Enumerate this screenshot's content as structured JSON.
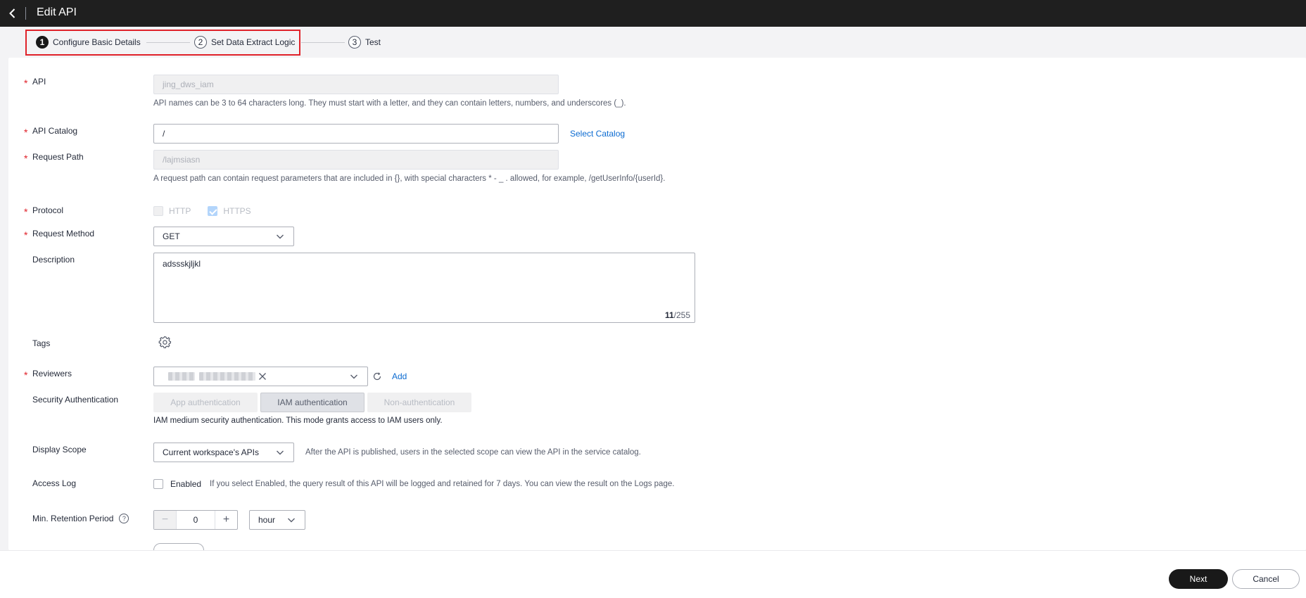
{
  "header": {
    "title": "Edit API"
  },
  "steps": [
    {
      "num": "1",
      "label": "Configure Basic Details"
    },
    {
      "num": "2",
      "label": "Set Data Extract Logic"
    },
    {
      "num": "3",
      "label": "Test"
    }
  ],
  "form": {
    "api": {
      "label": "API",
      "value": "jing_dws_iam",
      "hint": "API names can be 3 to 64 characters long. They must start with a letter, and they can contain letters, numbers, and underscores (_)."
    },
    "catalog": {
      "label": "API Catalog",
      "value": "/",
      "link": "Select Catalog"
    },
    "path": {
      "label": "Request Path",
      "value": "/lajmsiasn",
      "hint": "A request path can contain request parameters that are included in {}, with special characters * - _ . allowed, for example, /getUserInfo/{userId}."
    },
    "protocol": {
      "label": "Protocol",
      "http": "HTTP",
      "https": "HTTPS",
      "https_checked": true
    },
    "method": {
      "label": "Request Method",
      "value": "GET"
    },
    "description": {
      "label": "Description",
      "value": "adssskjljkl",
      "count": "11",
      "max": "/255"
    },
    "tags": {
      "label": "Tags"
    },
    "reviewers": {
      "label": "Reviewers",
      "add": "Add"
    },
    "security": {
      "label": "Security Authentication",
      "options": [
        "App authentication",
        "IAM authentication",
        "Non-authentication"
      ],
      "selected": "IAM authentication",
      "hint": "IAM medium security authentication. This mode grants access to IAM users only."
    },
    "scope": {
      "label": "Display Scope",
      "value": "Current workspace's APIs",
      "hint": "After the API is published, users in the selected scope can view the API in the service catalog."
    },
    "access_log": {
      "label": "Access Log",
      "option": "Enabled",
      "hint": "If you select Enabled, the query result of this API will be logged and retained for 7 days. You can view the result on the Logs page."
    },
    "retention": {
      "label": "Min. Retention Period",
      "value": "0",
      "unit": "hour"
    }
  },
  "footer": {
    "next": "Next",
    "cancel": "Cancel"
  },
  "colors": {
    "accent": "#0c6bd1",
    "required": "#e0222a",
    "primary_btn": "#191919",
    "highlight": "#e0222a"
  }
}
